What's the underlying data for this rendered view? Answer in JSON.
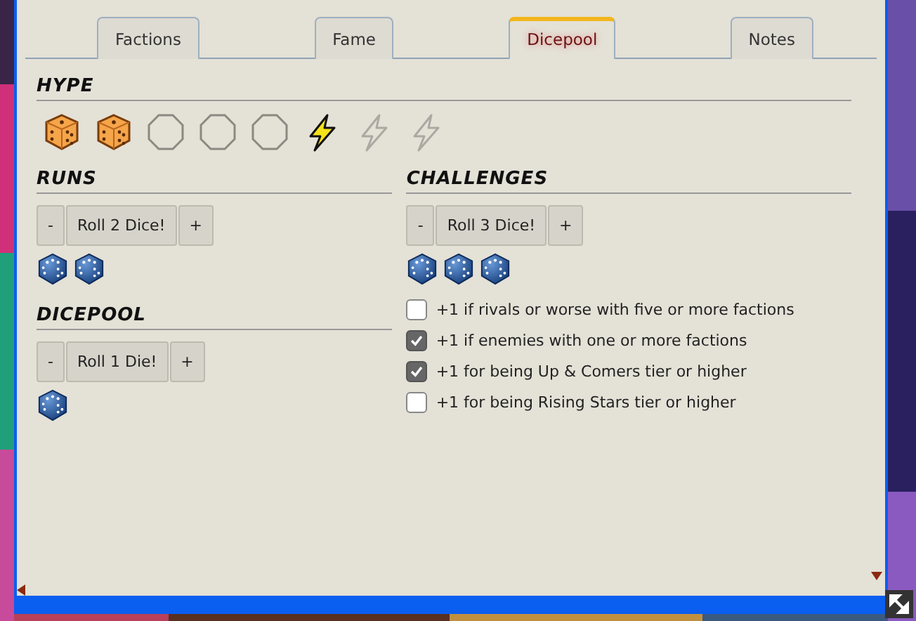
{
  "tabs": [
    {
      "label": "Factions",
      "selected": false
    },
    {
      "label": "Fame",
      "selected": false
    },
    {
      "label": "Dicepool",
      "selected": true
    },
    {
      "label": "Notes",
      "selected": false
    }
  ],
  "hype": {
    "title": "HYPE",
    "marks": [
      {
        "kind": "die",
        "filled": true
      },
      {
        "kind": "die",
        "filled": true
      },
      {
        "kind": "die",
        "filled": false
      },
      {
        "kind": "die",
        "filled": false
      },
      {
        "kind": "die",
        "filled": false
      },
      {
        "kind": "bolt",
        "filled": true
      },
      {
        "kind": "bolt",
        "filled": false
      },
      {
        "kind": "bolt",
        "filled": false
      }
    ]
  },
  "runs": {
    "title": "RUNS",
    "minus": "-",
    "roll": "Roll 2 Dice!",
    "plus": "+",
    "dice": [
      {
        "kind": "die"
      },
      {
        "kind": "die"
      }
    ]
  },
  "dicepool": {
    "title": "DICEPOOL",
    "minus": "-",
    "roll": "Roll 1 Die!",
    "plus": "+",
    "dice": [
      {
        "kind": "die"
      }
    ]
  },
  "challenges": {
    "title": "CHALLENGES",
    "minus": "-",
    "roll": "Roll 3 Dice!",
    "plus": "+",
    "dice": [
      {
        "kind": "die"
      },
      {
        "kind": "die"
      },
      {
        "kind": "die"
      }
    ],
    "options": [
      {
        "label": "+1 if rivals or worse with five or more factions",
        "checked": false
      },
      {
        "label": "+1 if enemies with one or more factions",
        "checked": true
      },
      {
        "label": "+1 for being Up & Comers tier or higher",
        "checked": true
      },
      {
        "label": "+1 for being Rising Stars tier or higher",
        "checked": false
      }
    ]
  }
}
